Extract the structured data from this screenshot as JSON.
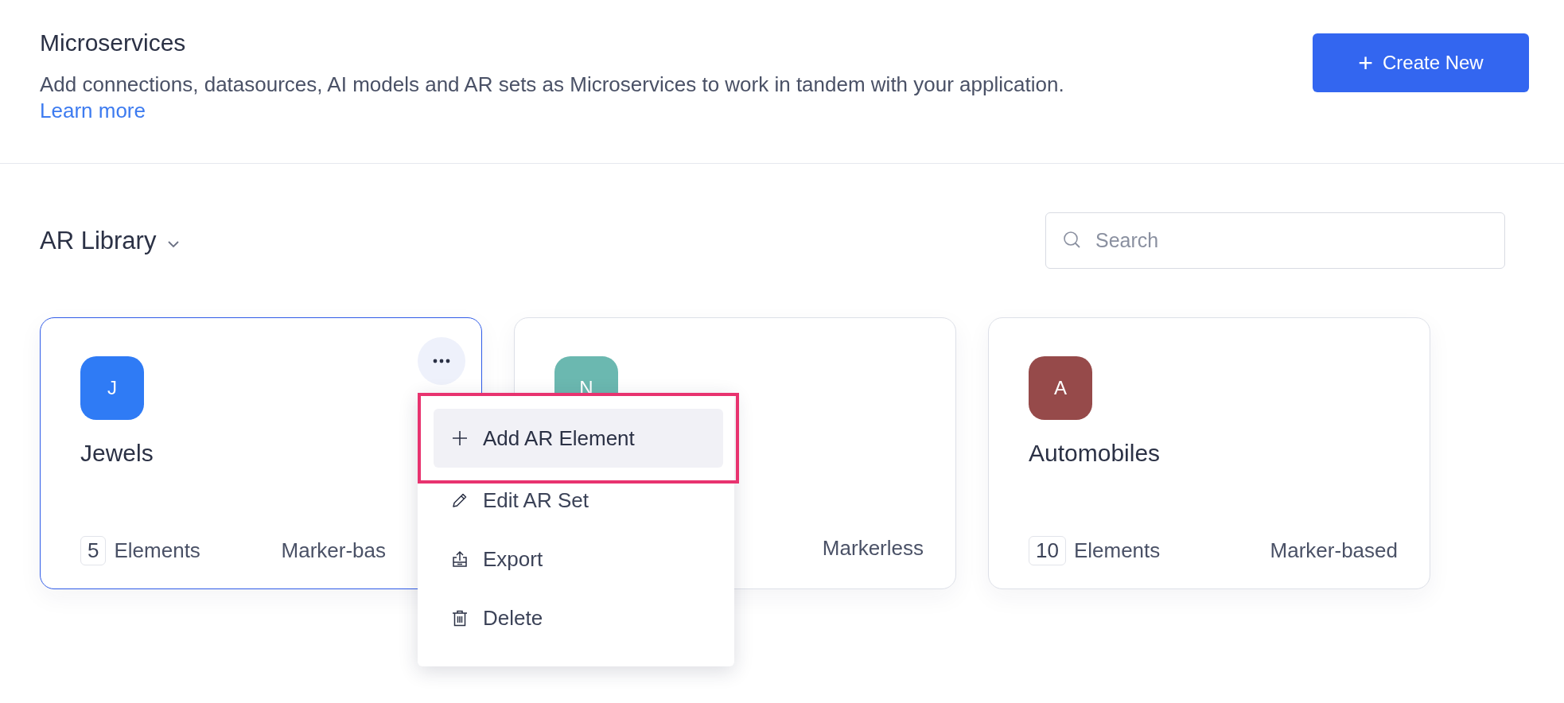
{
  "header": {
    "title": "Microservices",
    "description": "Add connections, datasources, AI models and AR sets as Microservices to work in tandem with your application.",
    "link": "Learn more",
    "create_button": {
      "icon": "+",
      "label": "Create New"
    }
  },
  "library": {
    "title": "AR Library",
    "search": {
      "placeholder": "Search"
    }
  },
  "cards": [
    {
      "initial": "J",
      "color": "#2f7bf5",
      "name": "Jewels",
      "count": "5",
      "count_label": "Elements",
      "type": "Marker-bas",
      "selected": true,
      "menu_open": true
    },
    {
      "initial": "N",
      "color": "#6bb8b0",
      "type": "Markerless",
      "selected": false,
      "menu_open": false
    },
    {
      "initial": "A",
      "color": "#964a4a",
      "name": "Automobiles",
      "count": "10",
      "count_label": "Elements",
      "type": "Marker-based",
      "selected": false,
      "menu_open": false
    }
  ],
  "menu": {
    "items": [
      {
        "kind": "plus",
        "label": "Add AR Element",
        "selected": true
      },
      {
        "kind": "pencil",
        "label": "Edit AR Set",
        "selected": false
      },
      {
        "kind": "export",
        "label": "Export",
        "selected": false
      },
      {
        "kind": "trash",
        "label": "Delete",
        "selected": false
      }
    ]
  }
}
